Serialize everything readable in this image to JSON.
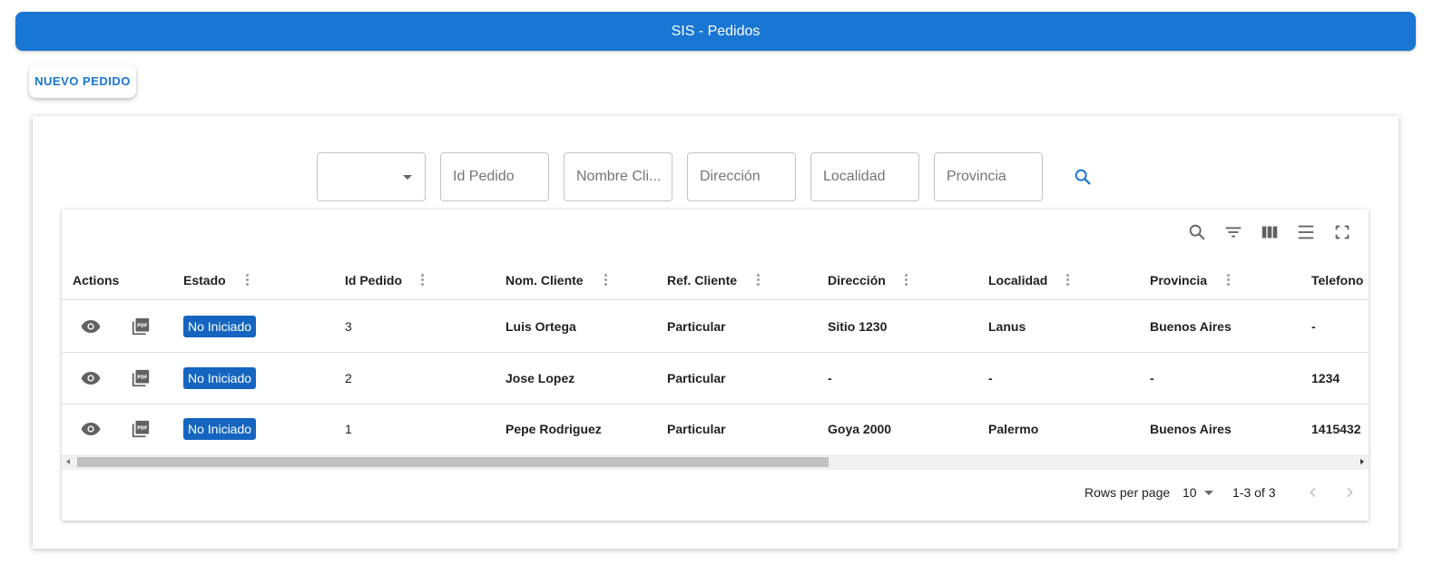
{
  "appbar": {
    "title": "SIS - Pedidos"
  },
  "actions": {
    "new_order_label": "NUEVO PEDIDO"
  },
  "filters": {
    "estado_value": "",
    "id_pedido_placeholder": "Id Pedido",
    "nombre_cliente_placeholder": "Nombre Cli...",
    "direccion_placeholder": "Dirección",
    "localidad_placeholder": "Localidad",
    "provincia_placeholder": "Provincia"
  },
  "toolbar_icons": [
    "search-icon",
    "filter-list-icon",
    "view-column-icon",
    "density-icon",
    "fullscreen-icon"
  ],
  "table": {
    "columns": [
      "Actions",
      "Estado",
      "Id Pedido",
      "Nom. Cliente",
      "Ref. Cliente",
      "Dirección",
      "Localidad",
      "Provincia",
      "Telefono"
    ],
    "rows": [
      {
        "estado": "No Iniciado",
        "id": "3",
        "cliente": "Luis Ortega",
        "ref": "Particular",
        "direccion": "Sitio 1230",
        "localidad": "Lanus",
        "provincia": "Buenos Aires",
        "telefono": "-"
      },
      {
        "estado": "No Iniciado",
        "id": "2",
        "cliente": "Jose Lopez",
        "ref": "Particular",
        "direccion": "-",
        "localidad": "-",
        "provincia": "-",
        "telefono": "1234"
      },
      {
        "estado": "No Iniciado",
        "id": "1",
        "cliente": "Pepe Rodriguez",
        "ref": "Particular",
        "direccion": "Goya 2000",
        "localidad": "Palermo",
        "provincia": "Buenos Aires",
        "telefono": "1415432"
      }
    ]
  },
  "pagination": {
    "rows_per_page_label": "Rows per page",
    "rows_per_page_value": "10",
    "range": "1-3 of 3"
  },
  "colors": {
    "primary": "#1976d2",
    "badge": "#1565c0"
  }
}
